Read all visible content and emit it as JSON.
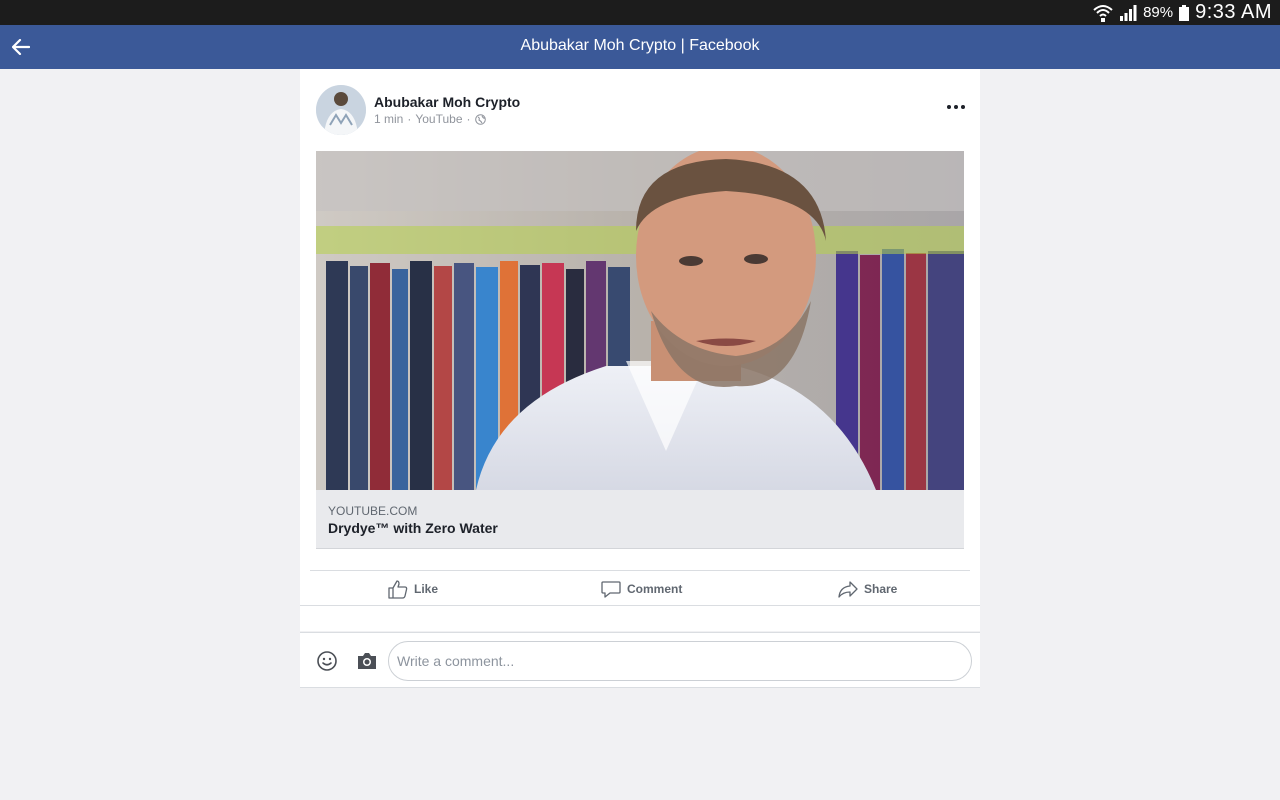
{
  "status_bar": {
    "battery_percent": "89%",
    "time": "9:33 AM",
    "icons": [
      "wifi-icon",
      "signal-icon",
      "battery-icon"
    ]
  },
  "app_bar": {
    "title": "Abubakar Moh Crypto | Facebook",
    "back_icon": "back-arrow-icon",
    "color": "#3b5998"
  },
  "post": {
    "author": "Abubakar Moh Crypto",
    "time": "1 min",
    "source": "YouTube",
    "separator": "·",
    "privacy_icon": "globe-icon",
    "more_icon": "more-options-icon",
    "link": {
      "domain": "YOUTUBE.COM",
      "title": "Drydye™ with Zero Water"
    },
    "actions": {
      "like": "Like",
      "comment": "Comment",
      "share": "Share"
    }
  },
  "composer": {
    "placeholder": "Write a comment...",
    "value": "",
    "emoji_icon": "emoji-icon",
    "camera_icon": "camera-icon"
  }
}
